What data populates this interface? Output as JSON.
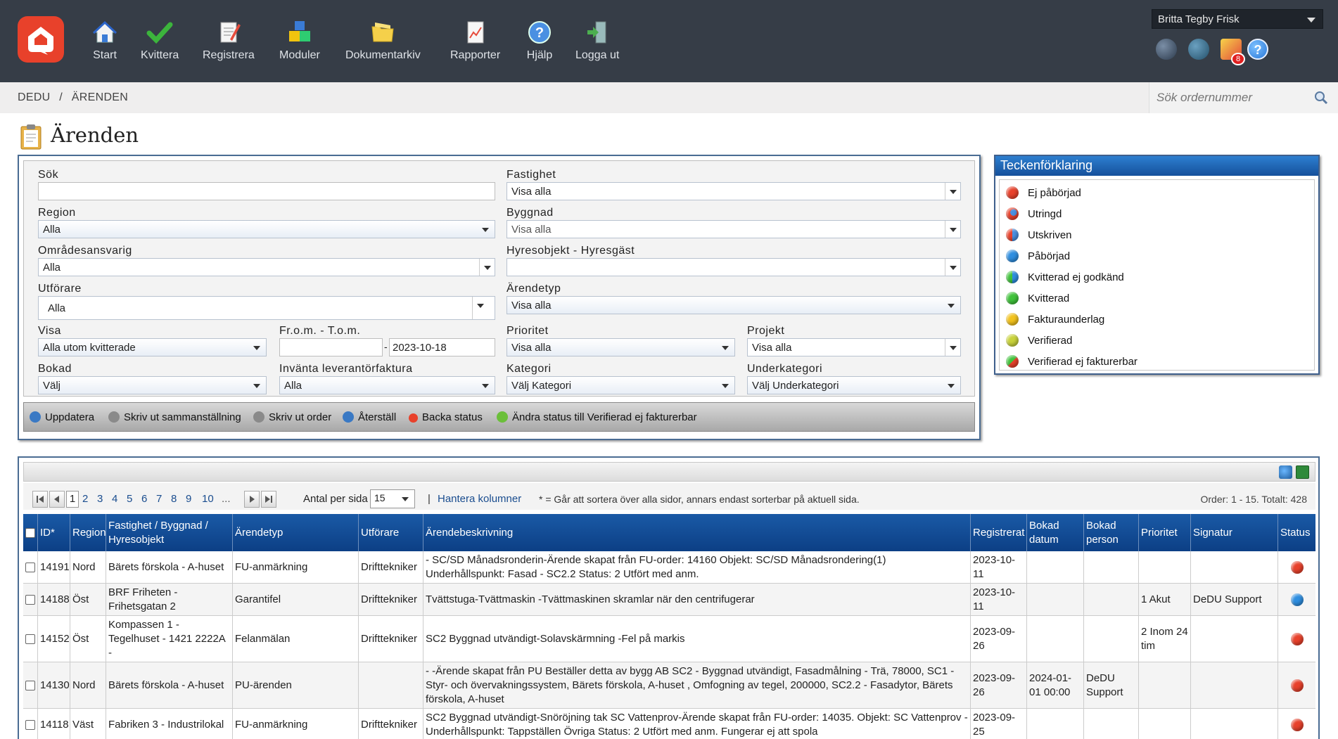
{
  "nav": {
    "items": [
      {
        "label": "Start",
        "icon": "house-icon"
      },
      {
        "label": "Kvittera",
        "icon": "checkmark-icon"
      },
      {
        "label": "Registrera",
        "icon": "register-icon"
      },
      {
        "label": "Moduler",
        "icon": "modules-icon"
      },
      {
        "label": "Dokumentarkiv",
        "icon": "folder-icon"
      },
      {
        "label": "Rapporter",
        "icon": "report-icon"
      },
      {
        "label": "Hjälp",
        "icon": "help-icon"
      },
      {
        "label": "Logga ut",
        "icon": "logout-icon"
      }
    ],
    "user": "Britta Tegby Frisk",
    "notification_count": "8"
  },
  "breadcrumb": {
    "root": "DEDU",
    "sep": "/",
    "current": "ÄRENDEN"
  },
  "order_search": {
    "placeholder": "Sök ordernummer"
  },
  "page_title": "Ärenden",
  "filters": {
    "sok": {
      "label": "Sök",
      "value": ""
    },
    "fastighet": {
      "label": "Fastighet",
      "value": "Visa alla"
    },
    "region": {
      "label": "Region",
      "value": "Alla"
    },
    "byggnad": {
      "label": "Byggnad",
      "value": "Visa alla"
    },
    "omradesansvarig": {
      "label": "Områdesansvarig",
      "value": "Alla"
    },
    "hyresobjekt": {
      "label": "Hyresobjekt - Hyresgäst",
      "value": ""
    },
    "utforare": {
      "label": "Utförare",
      "value": "Alla"
    },
    "arendetyp": {
      "label": "Ärendetyp",
      "value": "Visa alla"
    },
    "visa": {
      "label": "Visa",
      "value": "Alla utom kvitterade"
    },
    "datum": {
      "label": "Fr.o.m. - T.o.m.",
      "from": "",
      "dash": "-",
      "to": "2023-10-18"
    },
    "prioritet": {
      "label": "Prioritet",
      "value": "Visa alla"
    },
    "projekt": {
      "label": "Projekt",
      "value": "Visa alla"
    },
    "bokad": {
      "label": "Bokad",
      "value": "Välj"
    },
    "invanta": {
      "label": "Invänta leverantörfaktura",
      "value": "Alla"
    },
    "kategori": {
      "label": "Kategori",
      "value": "Välj Kategori"
    },
    "underkategori": {
      "label": "Underkategori",
      "value": "Välj Underkategori"
    }
  },
  "actions": [
    {
      "label": "Uppdatera",
      "color": "#3a79c4"
    },
    {
      "label": "Skriv ut sammanställning",
      "color": "#8a8a8a"
    },
    {
      "label": "Skriv ut order",
      "color": "#8a8a8a"
    },
    {
      "label": "Återställ",
      "color": "#3a79c4"
    },
    {
      "label": "Backa status",
      "color": "#e8412b"
    },
    {
      "label": "Ändra status till Verifierad ej fakturerbar",
      "color": "#6bbf3a"
    }
  ],
  "legend": {
    "title": "Teckenförklaring",
    "items": [
      {
        "label": "Ej påbörjad",
        "color": "#e8412b"
      },
      {
        "label": "Utringd",
        "color": "#e86a2b"
      },
      {
        "label": "Utskriven",
        "color": "#e85a4b"
      },
      {
        "label": "Påbörjad",
        "color": "#2e8ee0"
      },
      {
        "label": "Kvitterad ej godkänd",
        "color": "#4bb86a"
      },
      {
        "label": "Kvitterad",
        "color": "#3fc23a"
      },
      {
        "label": "Fakturaunderlag",
        "color": "#f2c21c"
      },
      {
        "label": "Verifierad",
        "color": "#c8d23a"
      },
      {
        "label": "Verifierad ej fakturerbar",
        "color": "#d85a3a"
      }
    ]
  },
  "pager": {
    "pages": [
      "1",
      "2",
      "3",
      "4",
      "5",
      "6",
      "7",
      "8",
      "9",
      "10",
      "..."
    ],
    "per_page_label": "Antal per sida",
    "per_page_value": "15",
    "sep": "|",
    "manage_columns": "Hantera kolumner",
    "note": "* = Går att sortera över alla sidor, annars endast sorterbar på aktuell sida.",
    "summary": "Order: 1 - 15. Totalt: 428"
  },
  "table": {
    "columns": [
      "ID*",
      "Region",
      "Fastighet / Byggnad / Hyresobjekt",
      "Ärendetyp",
      "Utförare",
      "Ärendebeskrivning",
      "Registrerat",
      "Bokad datum",
      "Bokad person",
      "Prioritet",
      "Signatur",
      "Status"
    ],
    "rows": [
      {
        "id": "14191",
        "region": "Nord",
        "fastighet": "Bärets förskola - A-huset",
        "typ": "FU-anmärkning",
        "utforare": "Drifttekniker",
        "beskr": "- SC/SD Månadsronderin-Ärende skapat från FU-order: 14160 Objekt: SC/SD Månadsrondering(1) Underhållspunkt: Fasad - SC2.2 Status: 2 Utfört med anm.",
        "reg": "2023-10-11",
        "bdatum": "",
        "bperson": "",
        "prio": "",
        "sign": "",
        "status_color": "#e8412b"
      },
      {
        "id": "14188",
        "region": "Öst",
        "fastighet": "BRF Friheten - Frihetsgatan 2",
        "typ": "Garantifel",
        "utforare": "Drifttekniker",
        "beskr": "Tvättstuga-Tvättmaskin -Tvättmaskinen skramlar när den centrifugerar",
        "reg": "2023-10-11",
        "bdatum": "",
        "bperson": "",
        "prio": "1 Akut",
        "sign": "DeDU Support",
        "status_color": "#2e8ee0"
      },
      {
        "id": "14152",
        "region": "Öst",
        "fastighet": "Kompassen 1 - Tegelhuset - 1421 2222A -",
        "typ": "Felanmälan",
        "utforare": "Drifttekniker",
        "beskr": "SC2 Byggnad utvändigt-Solavskärmning -Fel på markis",
        "reg": "2023-09-26",
        "bdatum": "",
        "bperson": "",
        "prio": "2 Inom 24 tim",
        "sign": "",
        "status_color": "#e8412b"
      },
      {
        "id": "14130",
        "region": "Nord",
        "fastighet": "Bärets förskola - A-huset",
        "typ": "PU-ärenden",
        "utforare": "",
        "beskr": "- -Ärende skapat från PU Beställer detta av bygg AB SC2 - Byggnad utvändigt, Fasadmålning - Trä, 78000, SC1 - Styr- och övervakningssystem, Bärets förskola, A-huset , Omfogning av tegel, 200000, SC2.2 - Fasadytor, Bärets förskola, A-huset",
        "reg": "2023-09-26",
        "bdatum": "2024-01-01 00:00",
        "bperson": "DeDU Support",
        "prio": "",
        "sign": "",
        "status_color": "#e8412b"
      },
      {
        "id": "14118",
        "region": "Väst",
        "fastighet": "Fabriken 3 - Industrilokal",
        "typ": "FU-anmärkning",
        "utforare": "Drifttekniker",
        "beskr": "SC2 Byggnad utvändigt-Snöröjning tak SC Vattenprov-Ärende skapat från FU-order: 14035. Objekt: SC Vattenprov - Underhållspunkt: Tappställen Övriga Status: 2 Utfört med anm. Fungerar ej att spola",
        "reg": "2023-09-25",
        "bdatum": "",
        "bperson": "",
        "prio": "",
        "sign": "",
        "status_color": "#e8412b"
      }
    ]
  }
}
